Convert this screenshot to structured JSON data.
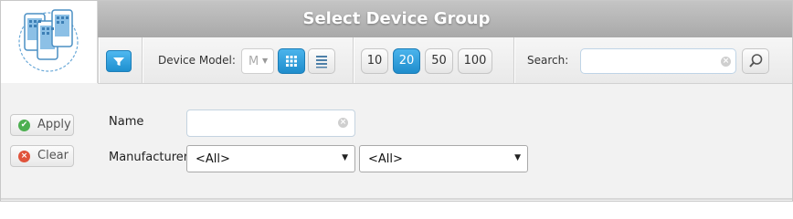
{
  "window": {
    "title": "Select Device Group"
  },
  "toolbar": {
    "filter_icon": "filter-icon",
    "device_model_label": "Device Model:",
    "device_model_value": "M",
    "view_grid_icon": "grid-view-icon",
    "view_list_icon": "list-view-icon",
    "page_sizes": [
      "10",
      "20",
      "50",
      "100"
    ],
    "page_size_selected": "20",
    "search_label": "Search:",
    "search_value": "",
    "search_icon": "magnifier-icon"
  },
  "actions": {
    "apply_label": "Apply",
    "clear_label": "Clear"
  },
  "form": {
    "name_label": "Name",
    "name_value": "",
    "manufacturer_label": "Manufacturer",
    "manufacturer_value": "<All>",
    "model_value": "<All>"
  },
  "colors": {
    "accent": "#2196d8",
    "apply_icon": "#4caf50",
    "clear_icon": "#e0533b",
    "title_bar": "#b5b5b5"
  }
}
